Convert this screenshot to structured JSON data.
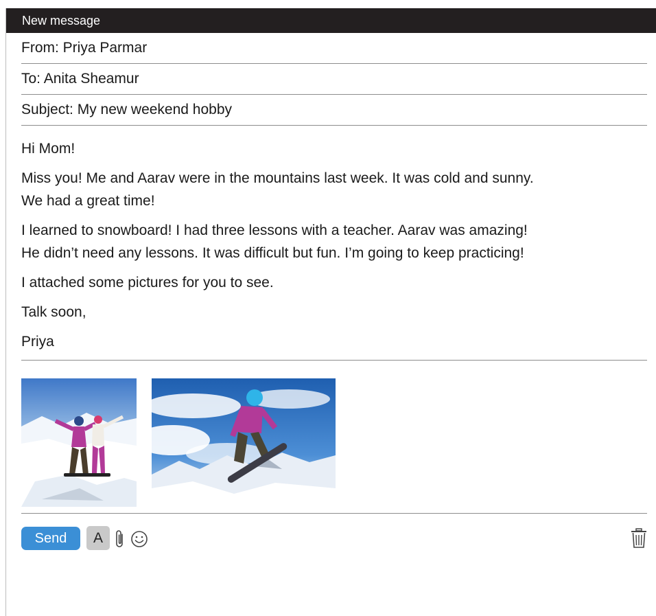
{
  "window": {
    "title": "New message"
  },
  "header": {
    "from": "From: Priya Parmar",
    "to": "To: Anita Sheamur",
    "subject": "Subject: My new weekend hobby"
  },
  "body": {
    "greeting": "Hi Mom!",
    "para1_line1": "Miss you! Me and Aarav were in the mountains last week. It was cold and sunny.",
    "para1_line2": "We had a great time!",
    "para2_line1": "I learned to snowboard! I had three lessons with a teacher. Aarav was amazing!",
    "para2_line2": "He didn’t need any lessons. It was difficult but fun. I’m going to keep practicing!",
    "para3": "I attached some pictures for you to see.",
    "closing": "Talk soon,",
    "signature": "Priya"
  },
  "attachments": [
    {
      "kind": "photo",
      "depicts": "two snowboarders on mountain"
    },
    {
      "kind": "photo",
      "depicts": "snowboarder jumping"
    }
  ],
  "toolbar": {
    "send_label": "Send",
    "format_label": "A",
    "attach_icon": "paperclip-icon",
    "emoji_icon": "smiley-icon",
    "delete_icon": "trash-icon"
  },
  "colors": {
    "titlebar_bg": "#231f20",
    "send_button": "#3b8fd6",
    "format_button": "#c9c9c9"
  }
}
